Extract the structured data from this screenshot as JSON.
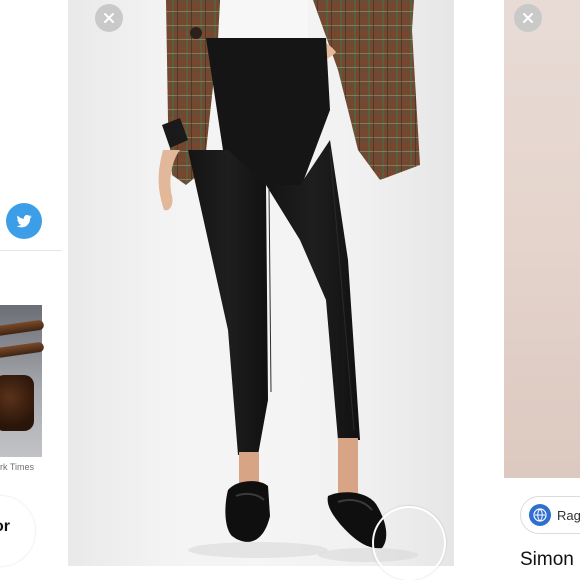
{
  "left_card": {
    "share_icon": "twitter-icon",
    "image_source": "rk Times",
    "label_cut": "or",
    "accent": "#3b9ee6"
  },
  "center_card": {
    "close_icon": "close-icon",
    "image_subject": "black-cropped-pants-photo"
  },
  "right_card": {
    "close_icon": "close-icon",
    "chip_icon": "globe-icon",
    "chip_label": "Rag",
    "title": "Simon",
    "accent": "#2f6fce"
  }
}
